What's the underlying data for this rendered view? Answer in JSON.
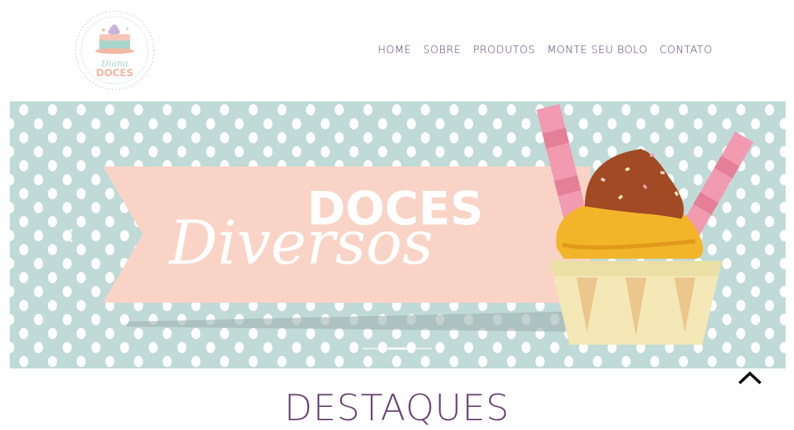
{
  "brand": {
    "logo_line1": "Diana",
    "logo_line2": "DOCES",
    "colors": {
      "purple": "#5b3a6e",
      "mint": "#bfdad7",
      "peach": "#f9d4c6",
      "cream": "#f3e8b6",
      "orange": "#f2b52a",
      "chocolate": "#a24a24",
      "pink": "#f29bb0"
    }
  },
  "nav": {
    "items": [
      {
        "label": "HOME"
      },
      {
        "label": "SOBRE"
      },
      {
        "label": "PRODUTOS"
      },
      {
        "label": "MONTE SEU BOLO"
      },
      {
        "label": "CONTATO"
      }
    ]
  },
  "carousel": {
    "slide": {
      "title_top": "DOCES",
      "title_script": "Diversos"
    },
    "indicator_count": 3,
    "active_indicator": 2,
    "prev_icon": "chevron-left-icon",
    "next_icon": "chevron-right-icon"
  },
  "back_to_top_icon": "chevron-up-icon",
  "section": {
    "title": "DESTAQUES"
  }
}
